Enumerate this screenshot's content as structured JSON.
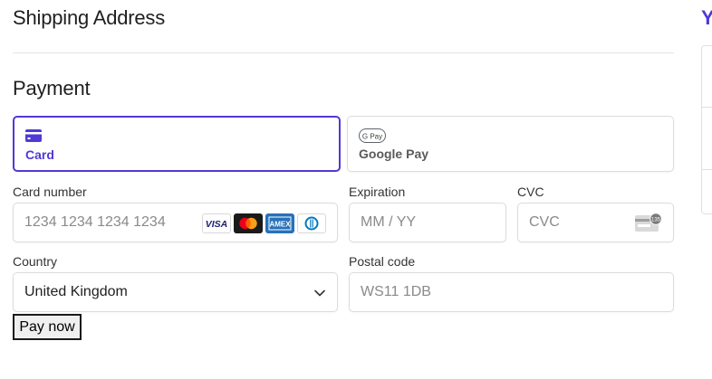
{
  "shipping": {
    "title": "Shipping Address"
  },
  "payment": {
    "title": "Payment",
    "methods": [
      {
        "label": "Card",
        "icon": "card-icon",
        "selected": true
      },
      {
        "label": "Google Pay",
        "icon": "google-pay-icon",
        "badge_text": "G Pay",
        "selected": false
      }
    ],
    "card_number": {
      "label": "Card number",
      "placeholder": "1234 1234 1234 1234"
    },
    "card_brands": [
      "visa",
      "mastercard",
      "amex",
      "diners"
    ],
    "expiration": {
      "label": "Expiration",
      "placeholder": "MM / YY"
    },
    "cvc": {
      "label": "CVC",
      "placeholder": "CVC",
      "icon_text": "135"
    },
    "country": {
      "label": "Country",
      "value": "United Kingdom"
    },
    "postal": {
      "label": "Postal code",
      "placeholder": "WS11 1DB"
    },
    "pay_button_label": "Pay now"
  },
  "summary": {
    "title_letter": "Y"
  },
  "colors": {
    "accent": "#4f3ad6",
    "border": "#dcdcdc",
    "text": "#1f1f1f"
  }
}
